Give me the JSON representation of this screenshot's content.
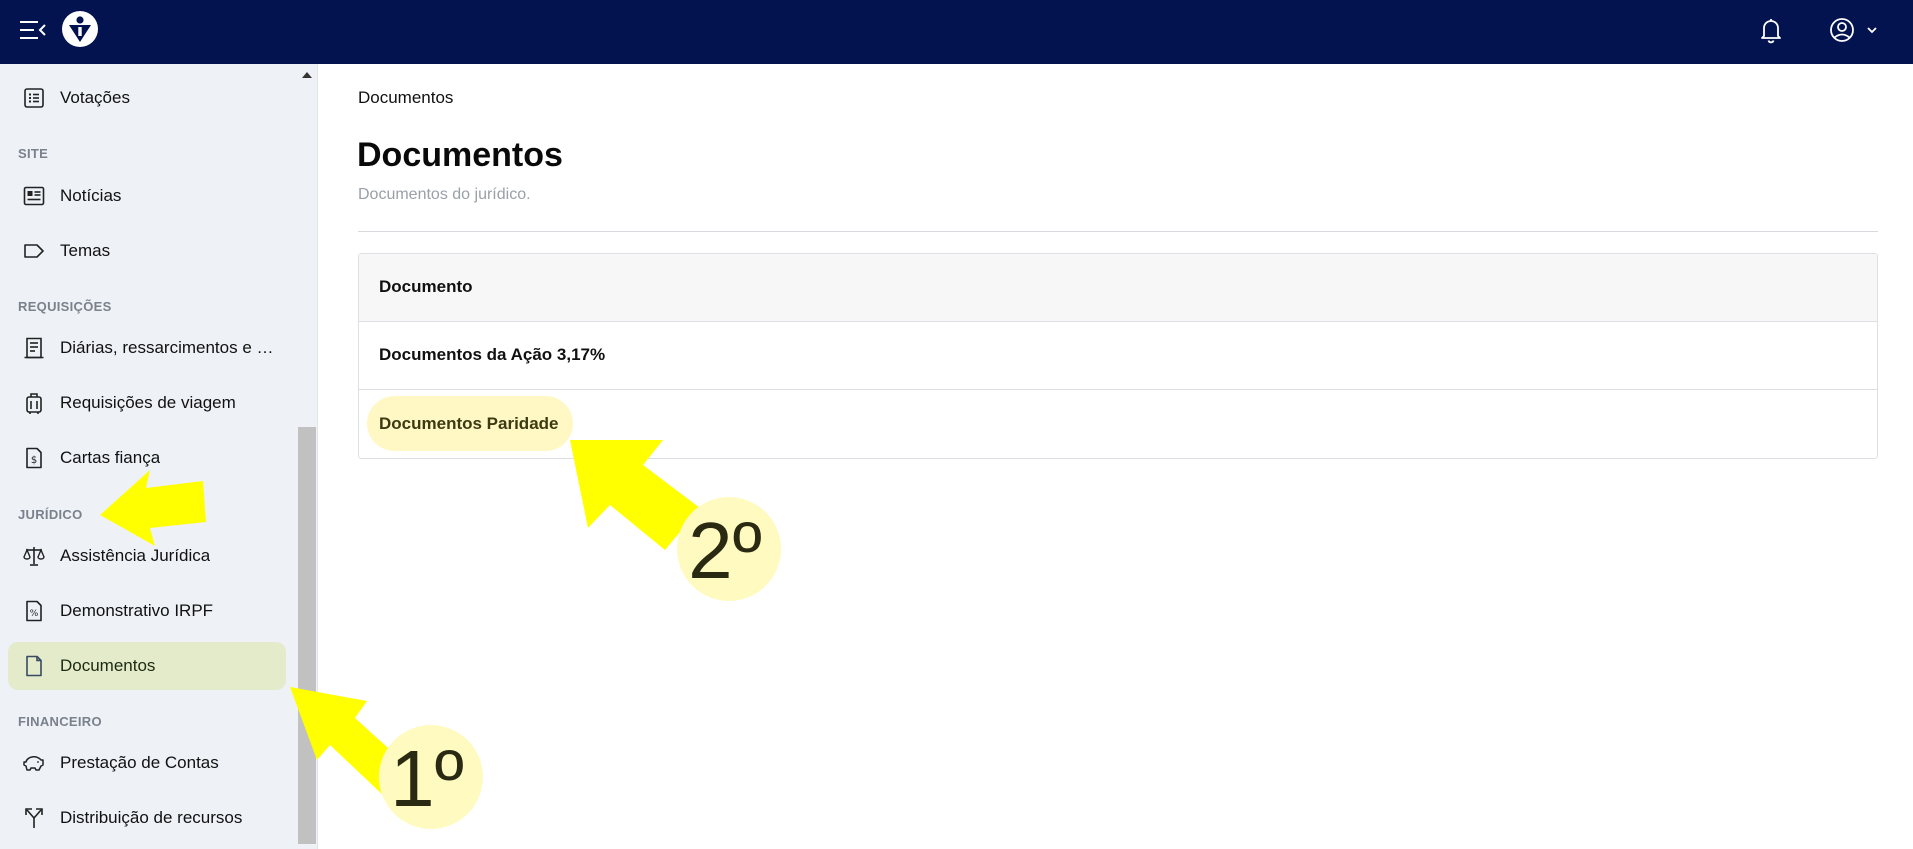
{
  "header": {
    "menu_icon": "menu-collapse-icon",
    "logo": "app-logo",
    "notifications_icon": "bell-icon",
    "account_icon": "user-circle-icon",
    "background": "#031350"
  },
  "sidebar": {
    "items_top": [
      {
        "label": "Votações",
        "icon": "checklist-icon"
      }
    ],
    "sections": {
      "site": "SITE",
      "requisicoes": "REQUISIÇÕES",
      "juridico": "JURÍDICO",
      "financeiro": "FINANCEIRO"
    },
    "site_items": [
      {
        "label": "Notícias",
        "icon": "newspaper-icon"
      },
      {
        "label": "Temas",
        "icon": "tag-icon"
      }
    ],
    "requisicoes_items": [
      {
        "label": "Diárias, ressarcimentos e adiantamentos",
        "icon": "receipt-icon"
      },
      {
        "label": "Requisições de viagem",
        "icon": "luggage-icon"
      },
      {
        "label": "Cartas fiança",
        "icon": "money-document-icon"
      }
    ],
    "juridico_items": [
      {
        "label": "Assistência Jurídica",
        "icon": "scale-icon"
      },
      {
        "label": "Demonstrativo IRPF",
        "icon": "percent-document-icon"
      },
      {
        "label": "Documentos",
        "icon": "document-icon",
        "active": true
      }
    ],
    "financeiro_items": [
      {
        "label": "Prestação de Contas",
        "icon": "piggy-bank-icon"
      },
      {
        "label": "Distribuição de recursos",
        "icon": "split-arrows-icon"
      }
    ],
    "active_color": "#e3ebcb"
  },
  "main": {
    "breadcrumb": "Documentos",
    "title": "Documentos",
    "subtitle": "Documentos do jurídico.",
    "table": {
      "header": "Documento",
      "rows": [
        "Documentos da Ação 3,17%",
        "Documentos Paridade"
      ]
    }
  },
  "annotations": {
    "step1": "1º",
    "step2": "2º",
    "arrow_color": "#ffff00",
    "badge_color": "#fffac0"
  }
}
